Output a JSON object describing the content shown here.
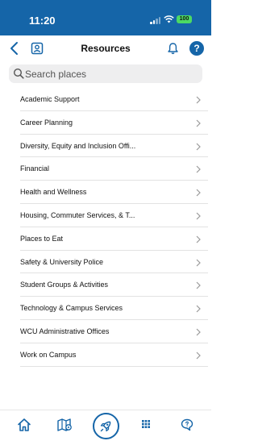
{
  "status_bar": {
    "time": "11:20",
    "battery": "100"
  },
  "header": {
    "title": "Resources"
  },
  "help_label": "?",
  "search": {
    "placeholder": "Search places"
  },
  "items": [
    {
      "label": "Academic Support"
    },
    {
      "label": "Career Planning"
    },
    {
      "label": "Diversity, Equity and Inclusion Offi..."
    },
    {
      "label": "Financial"
    },
    {
      "label": "Health and Wellness"
    },
    {
      "label": "Housing, Commuter Services, & T..."
    },
    {
      "label": "Places to Eat"
    },
    {
      "label": "Safety & University Police"
    },
    {
      "label": "Student Groups & Activities"
    },
    {
      "label": "Technology & Campus Services"
    },
    {
      "label": "WCU Administrative Offices"
    },
    {
      "label": "Work on Campus"
    }
  ],
  "colors": {
    "brand_blue": "#1565a8",
    "battery_green": "#4cd964"
  },
  "tab_bar": {
    "tabs": [
      {
        "icon": "home-icon"
      },
      {
        "icon": "map-location-icon"
      },
      {
        "icon": "rocket-icon"
      },
      {
        "icon": "apps-grid-icon"
      },
      {
        "icon": "chat-icon"
      }
    ]
  }
}
